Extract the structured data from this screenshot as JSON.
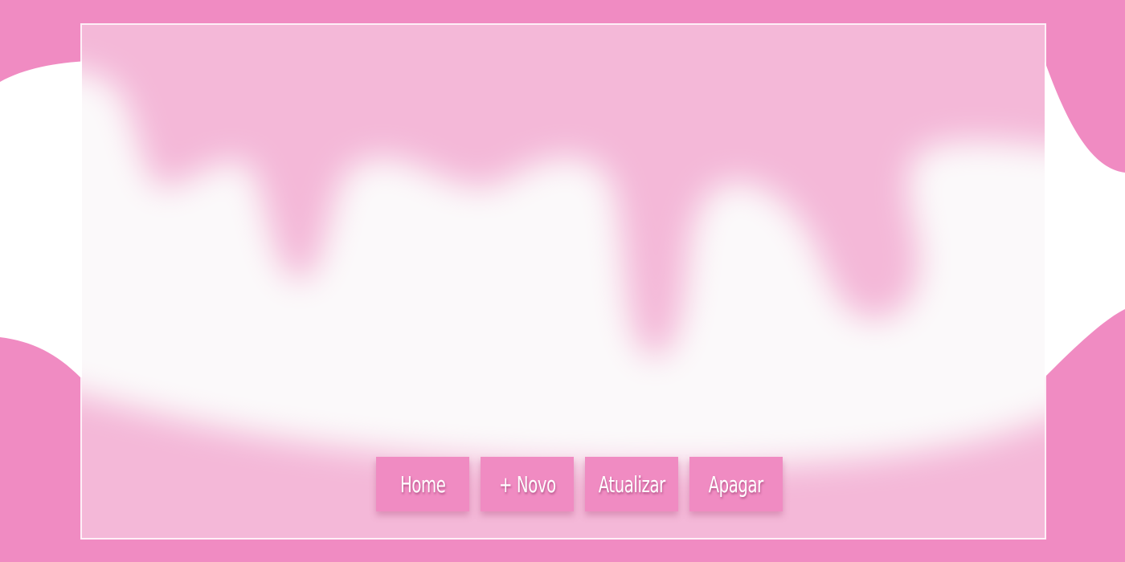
{
  "colors": {
    "brand_pink": "#f08bc2",
    "soft_pink": "#f4b6d7",
    "cream": "#fbf9fa",
    "panel_border": "#ffffff"
  },
  "toolbar": {
    "buttons": [
      {
        "label": "Home",
        "icon": ""
      },
      {
        "label": "+ Novo",
        "icon": ""
      },
      {
        "label": "Atualizar",
        "icon": ""
      },
      {
        "label": "Apagar",
        "icon": ""
      }
    ]
  }
}
